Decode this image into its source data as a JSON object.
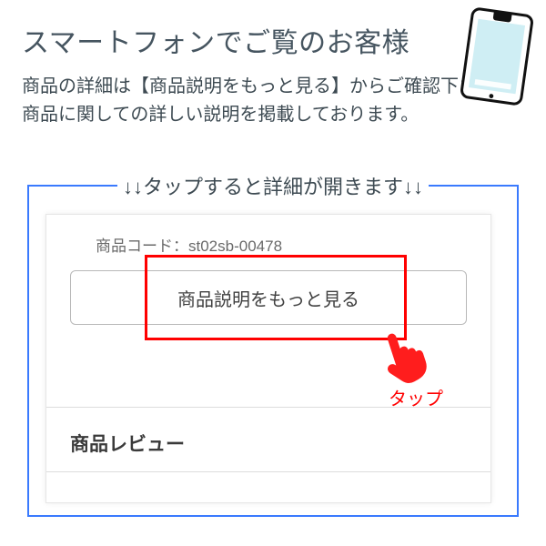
{
  "heading": "スマートフォンでご覧のお客様",
  "description_line1": "商品の詳細は【商品説明をもっと見る】からご確認下さい。",
  "description_line2": "商品に関しての詳しい説明を掲載しております。",
  "panel_legend": "↓↓タップすると詳細が開きます↓↓",
  "product_code_label": "商品コード：",
  "product_code_value": "st02sb-00478",
  "view_more_button": "商品説明をもっと見る",
  "tap_label": "タップ",
  "review_heading": "商品レビュー"
}
